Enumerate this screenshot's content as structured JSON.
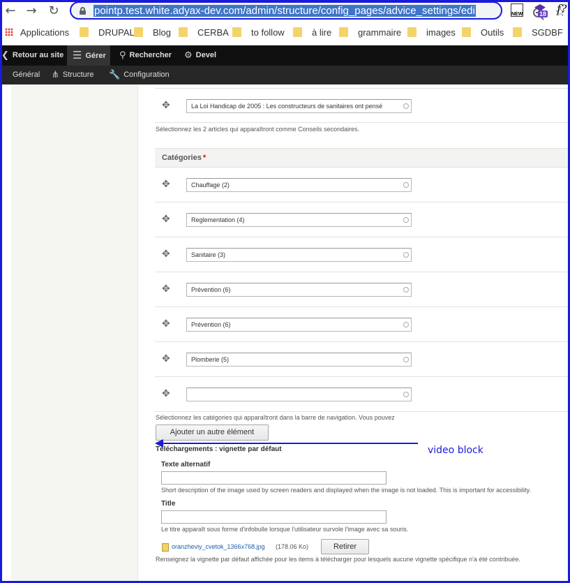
{
  "browser": {
    "url": "pointp.test.white.adyax-dev.com/admin/structure/config_pages/advice_settings/edi",
    "ext_new_label": "NEW",
    "ext_badge_count": "18",
    "ext_f_label": "f?",
    "bookmarks": [
      {
        "label": "Applications",
        "icon": "apps-icon"
      },
      {
        "label": "DRUPAL",
        "icon": "folder-icon"
      },
      {
        "label": "Blog",
        "icon": "folder-icon"
      },
      {
        "label": "CERBA",
        "icon": "folder-icon"
      },
      {
        "label": "to follow",
        "icon": "folder-icon"
      },
      {
        "label": "à lire",
        "icon": "folder-icon"
      },
      {
        "label": "grammaire",
        "icon": "folder-icon"
      },
      {
        "label": "images",
        "icon": "folder-icon"
      },
      {
        "label": "Outils",
        "icon": "folder-icon"
      },
      {
        "label": "SGDBF",
        "icon": "folder-icon"
      }
    ]
  },
  "toolbar": {
    "back": "Retour au site",
    "manage": "Gérer",
    "search": "Rechercher",
    "devel": "Devel",
    "tray": [
      "Général",
      "Structure",
      "Configuration"
    ]
  },
  "form": {
    "advice_row_value": "La Loi Handicap de 2005 : Les constructeurs de sanitaires ont pensé",
    "advice_desc": "Sélectionnez les 2 articles qui apparaîtront comme Conseils secondaires.",
    "categories_label": "Catégories",
    "required_mark": "*",
    "categories": [
      "Chauffage (2)",
      "Reglementation (4)",
      "Sanitaire (3)",
      "Prévention (6)",
      "Prévention (6)",
      "Plomberie (5)",
      ""
    ],
    "categories_desc": "Sélectionnez les catégories qui apparaîtront dans la barre de navigation. Vous pouvez",
    "add_button": "Ajouter un autre élément",
    "downloads_title": "Téléchargements : vignette par défaut",
    "alt_label": "Texte alternatif",
    "alt_value": "",
    "alt_desc": "Short description of the image used by screen readers and displayed when the image is not loaded. This is important for accessibility.",
    "title_label": "Title",
    "title_value": "",
    "title_desc": "Le titre apparaît sous forme d'infobulle lorsque l'utilisateur survole l'image avec sa souris.",
    "file_name": "oranzheviy_cvetok_1366x768.jpg",
    "file_size": "(178.06 Ko)",
    "remove_button": "Retirer",
    "file_desc": "Renseignez la vignette par défaut affichée pour les items à télécharger pour lesquels aucune vignette spécifique n'a été contribuée."
  },
  "annotation": {
    "text": "video block",
    "color": "#1a1adb"
  }
}
